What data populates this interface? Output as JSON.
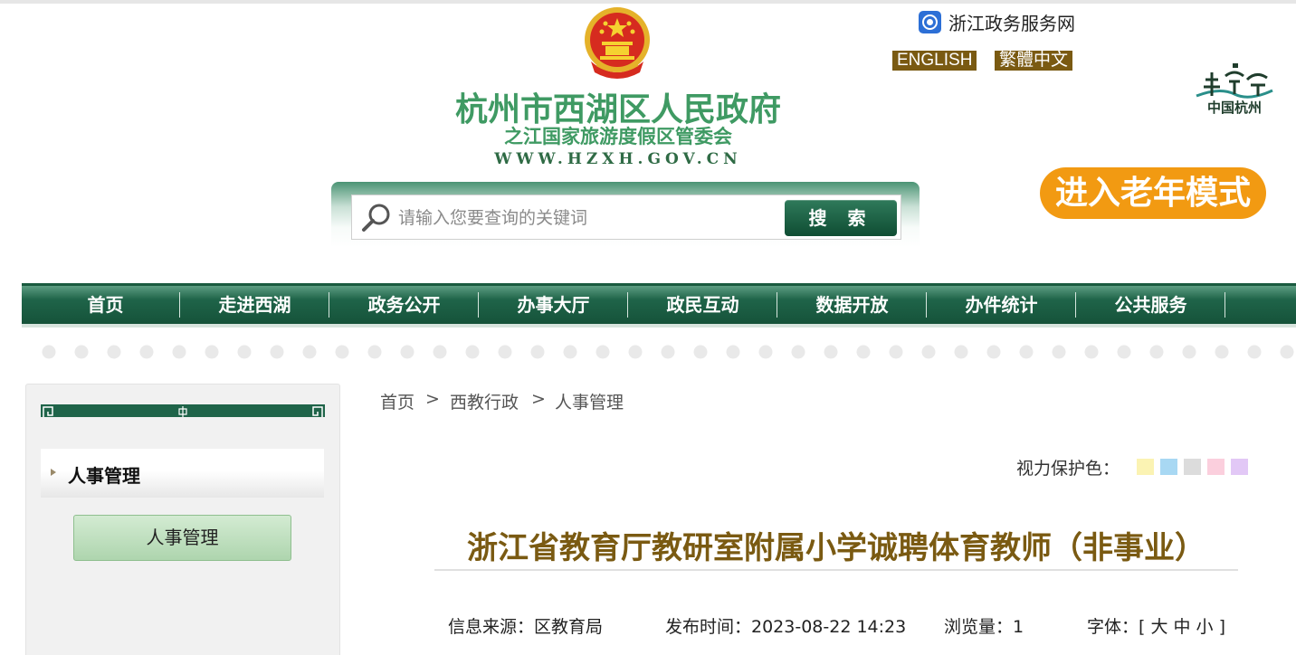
{
  "header": {
    "site_title": "杭州市西湖区人民政府",
    "site_subtitle": "之江国家旅游度假区管委会",
    "site_url": "WWW.HZXH.GOV.CN",
    "zhejiang_link": "浙江政务服务网",
    "lang_english": "ENGLISH",
    "lang_traditional": "繁體中文",
    "hangzhou_logo_text": "中国杭州",
    "elder_mode": "进入老年模式"
  },
  "search": {
    "placeholder": "请输入您要查询的关键词",
    "button": "搜 索"
  },
  "nav": {
    "items": [
      "首页",
      "走进西湖",
      "政务公开",
      "办事大厅",
      "政民互动",
      "数据开放",
      "办件统计",
      "公共服务"
    ]
  },
  "sidebar": {
    "heading": "人事管理",
    "items": [
      "人事管理"
    ]
  },
  "breadcrumb": {
    "items": [
      "首页",
      "西教行政",
      "人事管理"
    ],
    "separator": ">"
  },
  "vision": {
    "label": "视力保护色：",
    "colors": [
      "#fbf3b3",
      "#a8d8f3",
      "#dcdcdc",
      "#fbcfdd",
      "#e2c8f6"
    ]
  },
  "article": {
    "title": "浙江省教育厅教研室附属小学诚聘体育教师（非事业）",
    "source": "信息来源：区教育局",
    "published": "发布时间：2023-08-22 14:23",
    "views": "浏览量：1",
    "font_size": "字体：[ 大 中 小 ]"
  },
  "colors": {
    "brand_green": "#1f6449",
    "title_green": "#3f9a63",
    "accent_brown": "#7a5a12",
    "elder_orange": "#f29a12"
  }
}
